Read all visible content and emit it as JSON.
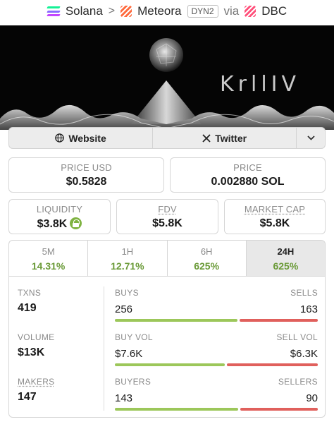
{
  "breadcrumb": {
    "chain": "Solana",
    "separator": ">",
    "dex": "Meteora",
    "pool_tag": "DYN2",
    "via": "via",
    "launchpad": "DBC"
  },
  "banner": {
    "logo_text": "KrllIV"
  },
  "links": {
    "website": "Website",
    "twitter": "Twitter"
  },
  "price_usd": {
    "label": "PRICE USD",
    "value": "$0.5828"
  },
  "price": {
    "label": "PRICE",
    "value": "0.002880 SOL"
  },
  "liquidity": {
    "label": "LIQUIDITY",
    "value": "$3.8K"
  },
  "fdv": {
    "label": "FDV",
    "value": "$5.8K"
  },
  "market_cap": {
    "label": "MARKET CAP",
    "value": "$5.8K"
  },
  "timeframes": [
    {
      "label": "5M",
      "change": "14.31%"
    },
    {
      "label": "1H",
      "change": "12.71%"
    },
    {
      "label": "6H",
      "change": "625%"
    },
    {
      "label": "24H",
      "change": "625%"
    }
  ],
  "active_timeframe": "24H",
  "stats": {
    "txns": {
      "label": "TXNS",
      "value": "419"
    },
    "volume": {
      "label": "VOLUME",
      "value": "$13K"
    },
    "makers": {
      "label": "MAKERS",
      "value": "147"
    },
    "buys": {
      "label": "BUYS",
      "value": "256",
      "sell_label": "SELLS",
      "sell_value": "163",
      "buy_share": 0.611
    },
    "buy_vol": {
      "label": "BUY VOL",
      "value": "$7.6K",
      "sell_label": "SELL VOL",
      "sell_value": "$6.3K",
      "buy_share": 0.547
    },
    "buyers": {
      "label": "BUYERS",
      "value": "143",
      "sell_label": "SELLERS",
      "sell_value": "90",
      "buy_share": 0.614
    }
  },
  "colors": {
    "positive": "#6a9a37",
    "buy_bar": "#9cc75a",
    "sell_bar": "#e0605c"
  }
}
